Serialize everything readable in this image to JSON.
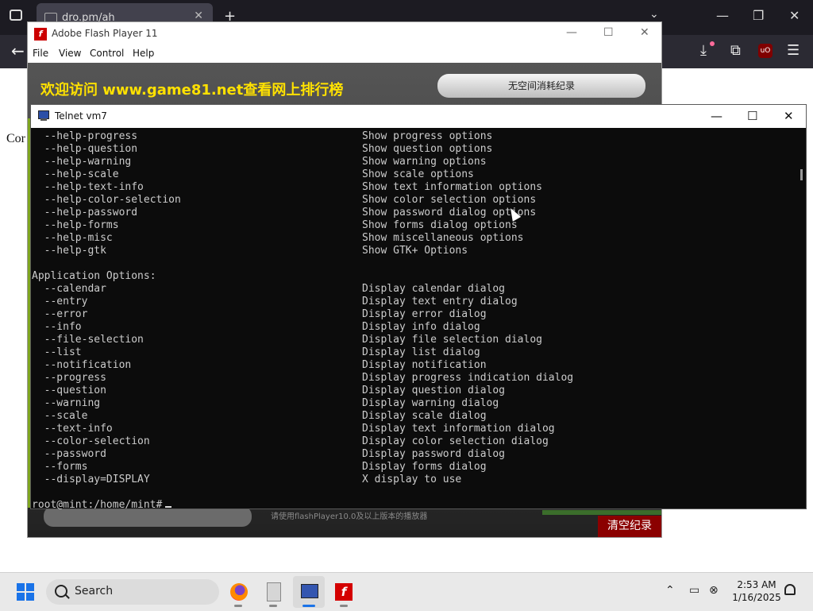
{
  "browser": {
    "tab_title": "dro.pm/ah",
    "tab_close": "✕",
    "new_tab": "+",
    "page_text": "Cor"
  },
  "flash": {
    "title": "Adobe Flash Player 11",
    "logo_glyph": "f",
    "menu": [
      "File",
      "View",
      "Control",
      "Help"
    ],
    "game": {
      "banner": "欢迎访问 www.game81.net查看网上排行榜",
      "pill": "无空间消耗纪录",
      "hint": "请使用flashPlayer10.0及以上版本的播放器",
      "clear": "清空纪录"
    }
  },
  "telnet": {
    "title": "Telnet vm7",
    "lines": [
      {
        "opt": "  --help-progress",
        "desc": "Show progress options"
      },
      {
        "opt": "  --help-question",
        "desc": "Show question options"
      },
      {
        "opt": "  --help-warning",
        "desc": "Show warning options"
      },
      {
        "opt": "  --help-scale",
        "desc": "Show scale options"
      },
      {
        "opt": "  --help-text-info",
        "desc": "Show text information options"
      },
      {
        "opt": "  --help-color-selection",
        "desc": "Show color selection options"
      },
      {
        "opt": "  --help-password",
        "desc": "Show password dialog options"
      },
      {
        "opt": "  --help-forms",
        "desc": "Show forms dialog options"
      },
      {
        "opt": "  --help-misc",
        "desc": "Show miscellaneous options"
      },
      {
        "opt": "  --help-gtk",
        "desc": "Show GTK+ Options"
      },
      {
        "opt": "",
        "desc": ""
      },
      {
        "opt": "Application Options:",
        "desc": ""
      },
      {
        "opt": "  --calendar",
        "desc": "Display calendar dialog"
      },
      {
        "opt": "  --entry",
        "desc": "Display text entry dialog"
      },
      {
        "opt": "  --error",
        "desc": "Display error dialog"
      },
      {
        "opt": "  --info",
        "desc": "Display info dialog"
      },
      {
        "opt": "  --file-selection",
        "desc": "Display file selection dialog"
      },
      {
        "opt": "  --list",
        "desc": "Display list dialog"
      },
      {
        "opt": "  --notification",
        "desc": "Display notification"
      },
      {
        "opt": "  --progress",
        "desc": "Display progress indication dialog"
      },
      {
        "opt": "  --question",
        "desc": "Display question dialog"
      },
      {
        "opt": "  --warning",
        "desc": "Display warning dialog"
      },
      {
        "opt": "  --scale",
        "desc": "Display scale dialog"
      },
      {
        "opt": "  --text-info",
        "desc": "Display text information dialog"
      },
      {
        "opt": "  --color-selection",
        "desc": "Display color selection dialog"
      },
      {
        "opt": "  --password",
        "desc": "Display password dialog"
      },
      {
        "opt": "  --forms",
        "desc": "Display forms dialog"
      },
      {
        "opt": "  --display=DISPLAY",
        "desc": "X display to use"
      }
    ],
    "prompt": "root@mint:/home/mint#"
  },
  "taskbar": {
    "search_label": "Search",
    "time": "2:53 AM",
    "date": "1/16/2025"
  },
  "colors": {
    "flash_banner": "#ffe100",
    "clear_button": "#8b0000",
    "terminal_bg": "#0c0c0c",
    "terminal_fg": "#cccccc"
  }
}
